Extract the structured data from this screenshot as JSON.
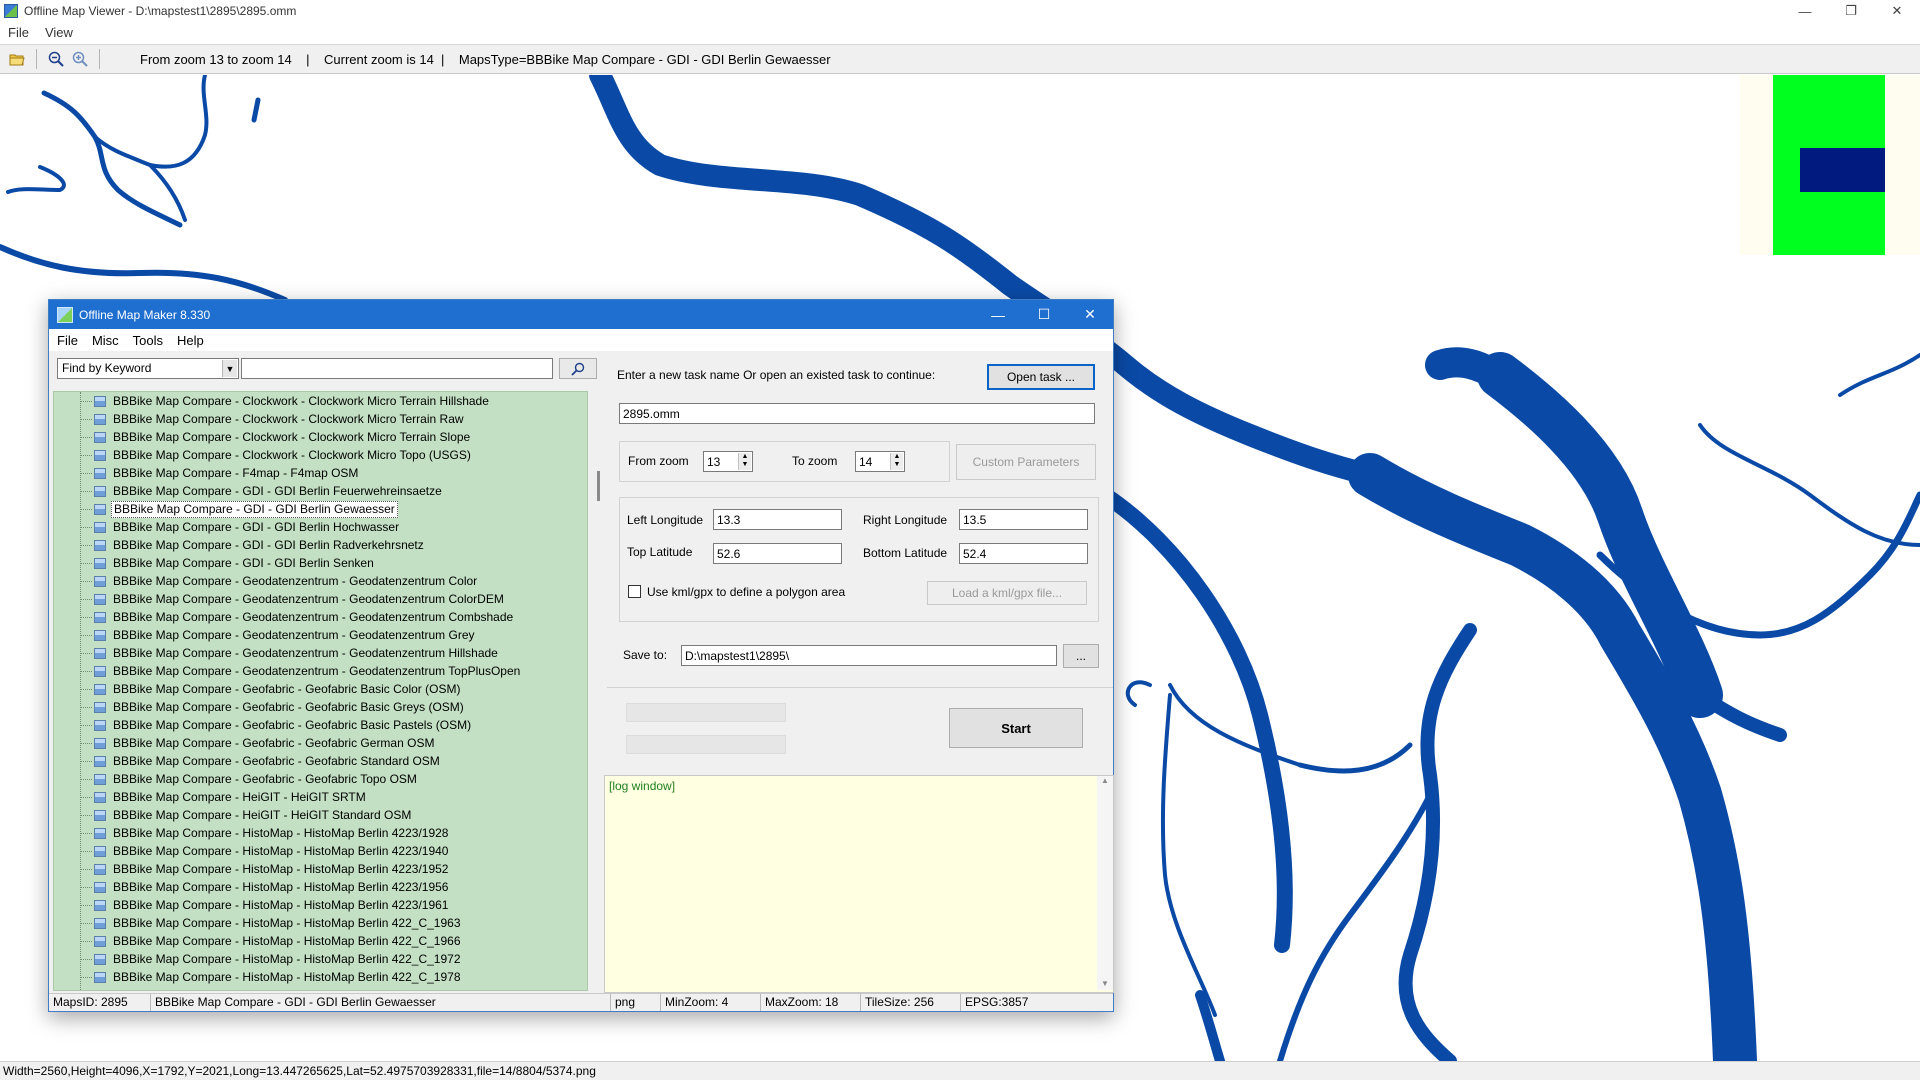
{
  "viewer": {
    "title": "Offline Map Viewer - D:\\mapstest1\\2895\\2895.omm",
    "menu": [
      "File",
      "View"
    ],
    "toolbar_info": "From zoom 13 to zoom 14    |    Current zoom is 14  |    MapsType=BBBike Map Compare - GDI - GDI Berlin Gewaesser",
    "icons": [
      "open-folder-icon",
      "zoom-out-icon",
      "zoom-in-icon"
    ],
    "status": "Width=2560,Height=4096,X=1792,Y=2021,Long=13.447265625,Lat=52.4975703928331,file=14/8804/5374.png",
    "colors": {
      "water": "#0a4aa6",
      "minimap_green": "#00ff1e",
      "minimap_blue": "#001a80"
    }
  },
  "omm": {
    "title": "Offline Map Maker 8.330",
    "menu": [
      "File",
      "Misc",
      "Tools",
      "Help"
    ],
    "search": {
      "combo_value": "Find by Keyword",
      "input_value": ""
    },
    "tree_items": [
      "BBBike Map Compare - Clockwork - Clockwork Micro Terrain Hillshade",
      "BBBike Map Compare - Clockwork - Clockwork Micro Terrain Raw",
      "BBBike Map Compare - Clockwork - Clockwork Micro Terrain Slope",
      "BBBike Map Compare - Clockwork - Clockwork Micro Topo (USGS)",
      "BBBike Map Compare - F4map - F4map OSM",
      "BBBike Map Compare - GDI - GDI Berlin Feuerwehreinsaetze",
      "BBBike Map Compare - GDI - GDI Berlin Gewaesser",
      "BBBike Map Compare - GDI - GDI Berlin Hochwasser",
      "BBBike Map Compare - GDI - GDI Berlin Radverkehrsnetz",
      "BBBike Map Compare - GDI - GDI Berlin Senken",
      "BBBike Map Compare - Geodatenzentrum - Geodatenzentrum Color",
      "BBBike Map Compare - Geodatenzentrum - Geodatenzentrum ColorDEM",
      "BBBike Map Compare - Geodatenzentrum - Geodatenzentrum Combshade",
      "BBBike Map Compare - Geodatenzentrum - Geodatenzentrum Grey",
      "BBBike Map Compare - Geodatenzentrum - Geodatenzentrum Hillshade",
      "BBBike Map Compare - Geodatenzentrum - Geodatenzentrum TopPlusOpen",
      "BBBike Map Compare - Geofabric - Geofabric Basic Color (OSM)",
      "BBBike Map Compare - Geofabric - Geofabric Basic Greys (OSM)",
      "BBBike Map Compare - Geofabric - Geofabric Basic Pastels (OSM)",
      "BBBike Map Compare - Geofabric - Geofabric German OSM",
      "BBBike Map Compare - Geofabric - Geofabric Standard OSM",
      "BBBike Map Compare - Geofabric - Geofabric Topo OSM",
      "BBBike Map Compare - HeiGIT - HeiGIT SRTM",
      "BBBike Map Compare - HeiGIT - HeiGIT Standard OSM",
      "BBBike Map Compare - HistoMap - HistoMap Berlin 4223/1928",
      "BBBike Map Compare - HistoMap - HistoMap Berlin 4223/1940",
      "BBBike Map Compare - HistoMap - HistoMap Berlin 4223/1952",
      "BBBike Map Compare - HistoMap - HistoMap Berlin 4223/1956",
      "BBBike Map Compare - HistoMap - HistoMap Berlin 4223/1961",
      "BBBike Map Compare - HistoMap - HistoMap Berlin 422_C_1963",
      "BBBike Map Compare - HistoMap - HistoMap Berlin 422_C_1966",
      "BBBike Map Compare - HistoMap - HistoMap Berlin 422_C_1972",
      "BBBike Map Compare - HistoMap - HistoMap Berlin 422_C_1978"
    ],
    "selected_item": "BBBike Map Compare - GDI - GDI Berlin Gewaesser",
    "task_prompt": "Enter a new task name Or open an existed task to continue:",
    "open_task_label": "Open task ...",
    "task_name": "2895.omm",
    "from_zoom_label": "From zoom",
    "from_zoom": "13",
    "to_zoom_label": "To zoom",
    "to_zoom": "14",
    "custom_params_label": "Custom Parameters",
    "left_lon_label": "Left Longitude",
    "left_lon": "13.3",
    "right_lon_label": "Right Longitude",
    "right_lon": "13.5",
    "top_lat_label": "Top Latitude",
    "top_lat": "52.6",
    "bottom_lat_label": "Bottom Latitude",
    "bottom_lat": "52.4",
    "kml_checkbox_label": "Use kml/gpx to define a polygon area",
    "kml_checked": false,
    "load_kml_label": "Load a kml/gpx file...",
    "save_to_label": "Save to:",
    "save_to": "D:\\mapstest1\\2895\\",
    "browse_label": "...",
    "start_label": "Start",
    "log_text": "[log window]",
    "status": {
      "maps_id": "MapsID: 2895",
      "map_name": "BBBike Map Compare - GDI - GDI Berlin Gewaesser",
      "format": "png",
      "min_zoom": "MinZoom: 4",
      "max_zoom": "MaxZoom: 18",
      "tile_size": "TileSize: 256",
      "epsg": "EPSG:3857"
    }
  }
}
